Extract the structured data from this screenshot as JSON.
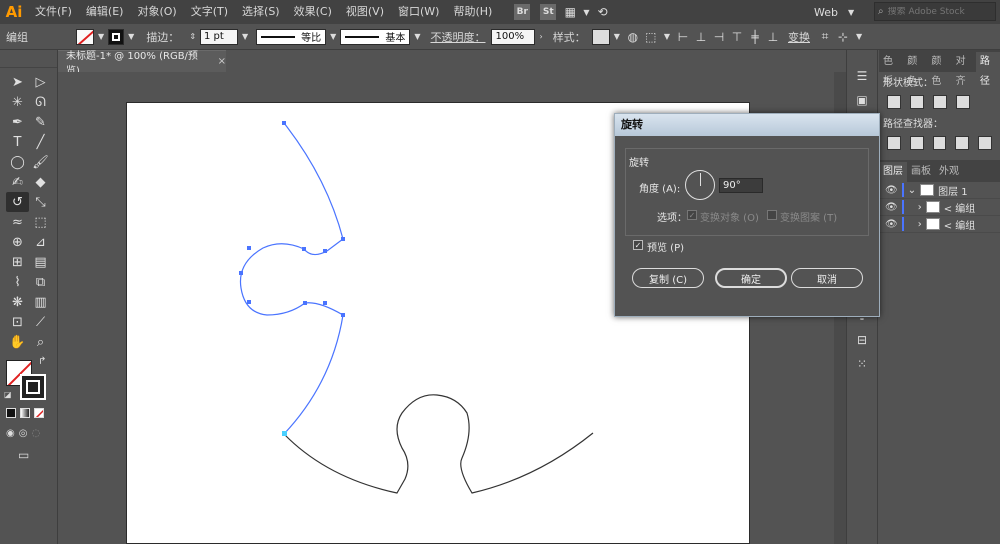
{
  "app": {
    "logo": "Ai"
  },
  "menu": [
    "文件(F)",
    "编辑(E)",
    "对象(O)",
    "文字(T)",
    "选择(S)",
    "效果(C)",
    "视图(V)",
    "窗口(W)",
    "帮助(H)"
  ],
  "menubar_icons": [
    "Br",
    "St"
  ],
  "workspace": {
    "label": "Web"
  },
  "search": {
    "placeholder": "搜索 Adobe Stock"
  },
  "controlbar": {
    "selection_label": "编组",
    "stroke_label": "描边：",
    "stroke_weight": "1 pt",
    "profile_label": "等比",
    "brush_label": "基本",
    "opacity_label": "不透明度：",
    "opacity_value": "100%",
    "style_label": "样式：",
    "transform_label": "变换"
  },
  "document_tab": {
    "title": "未标题-1* @ 100% (RGB/预览)",
    "close": "×"
  },
  "tools": [
    "selection-tool",
    "direct-selection-tool",
    "magic-wand-tool",
    "lasso-tool",
    "pen-tool",
    "curvature-tool",
    "type-tool",
    "line-tool",
    "ellipse-tool",
    "paintbrush-tool",
    "shaper-tool",
    "eraser-tool",
    "rotate-tool",
    "scale-tool",
    "width-tool",
    "free-transform-tool",
    "shape-builder-tool",
    "perspective-tool",
    "mesh-tool",
    "gradient-tool",
    "eyedropper-tool",
    "blend-tool",
    "symbol-sprayer-tool",
    "column-graph-tool",
    "artboard-tool",
    "slice-tool",
    "hand-tool",
    "zoom-tool"
  ],
  "right_panel": {
    "top_tabs": [
      "色板",
      "颜色",
      "颜色",
      "对齐",
      "路径"
    ],
    "shape_modes_label": "形状模式：",
    "pathfinder_label": "路径查找器：",
    "layer_tabs": [
      "图层",
      "画板",
      "外观"
    ],
    "layers": [
      {
        "name": "图层 1"
      },
      {
        "name": "< 编组"
      },
      {
        "name": "< 编组"
      }
    ]
  },
  "dialog": {
    "title": "旋转",
    "group_label": "旋转",
    "angle_label": "角度 (A):",
    "angle_value": "90°",
    "options_label": "选项：",
    "transform_objects": "变换对象 (O)",
    "transform_patterns": "变换图案 (T)",
    "preview_label": "预览 (P)",
    "copy_button": "复制 (C)",
    "ok_button": "确定",
    "cancel_button": "取消"
  },
  "colors": {
    "accent_orange": "#ff9a00",
    "selection_blue": "#4a74ff",
    "dialog_title": "#c6d4e2"
  }
}
